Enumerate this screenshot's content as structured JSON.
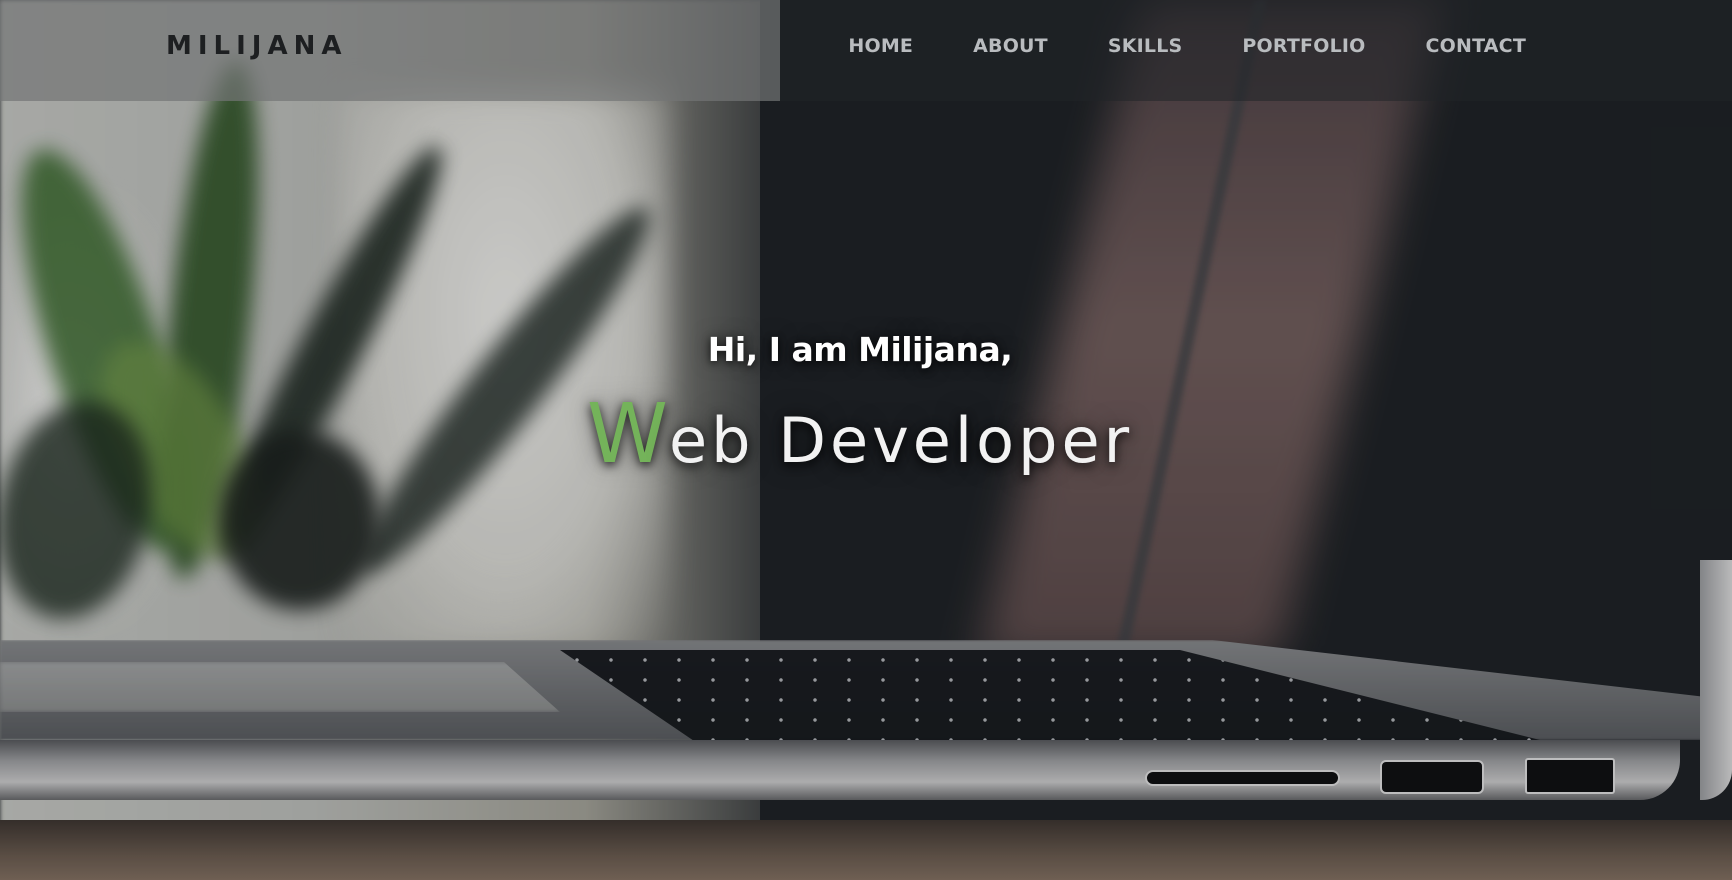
{
  "brand": {
    "name": "MILIJANA"
  },
  "nav": {
    "items": [
      {
        "label": "HOME"
      },
      {
        "label": "ABOUT"
      },
      {
        "label": "SKILLS"
      },
      {
        "label": "PORTFOLIO"
      },
      {
        "label": "CONTACT"
      }
    ]
  },
  "hero": {
    "greeting": "Hi, I am Milijana,",
    "title_first_letter": "W",
    "title_rest": "eb Developer",
    "accent_color": "#74b35a"
  }
}
